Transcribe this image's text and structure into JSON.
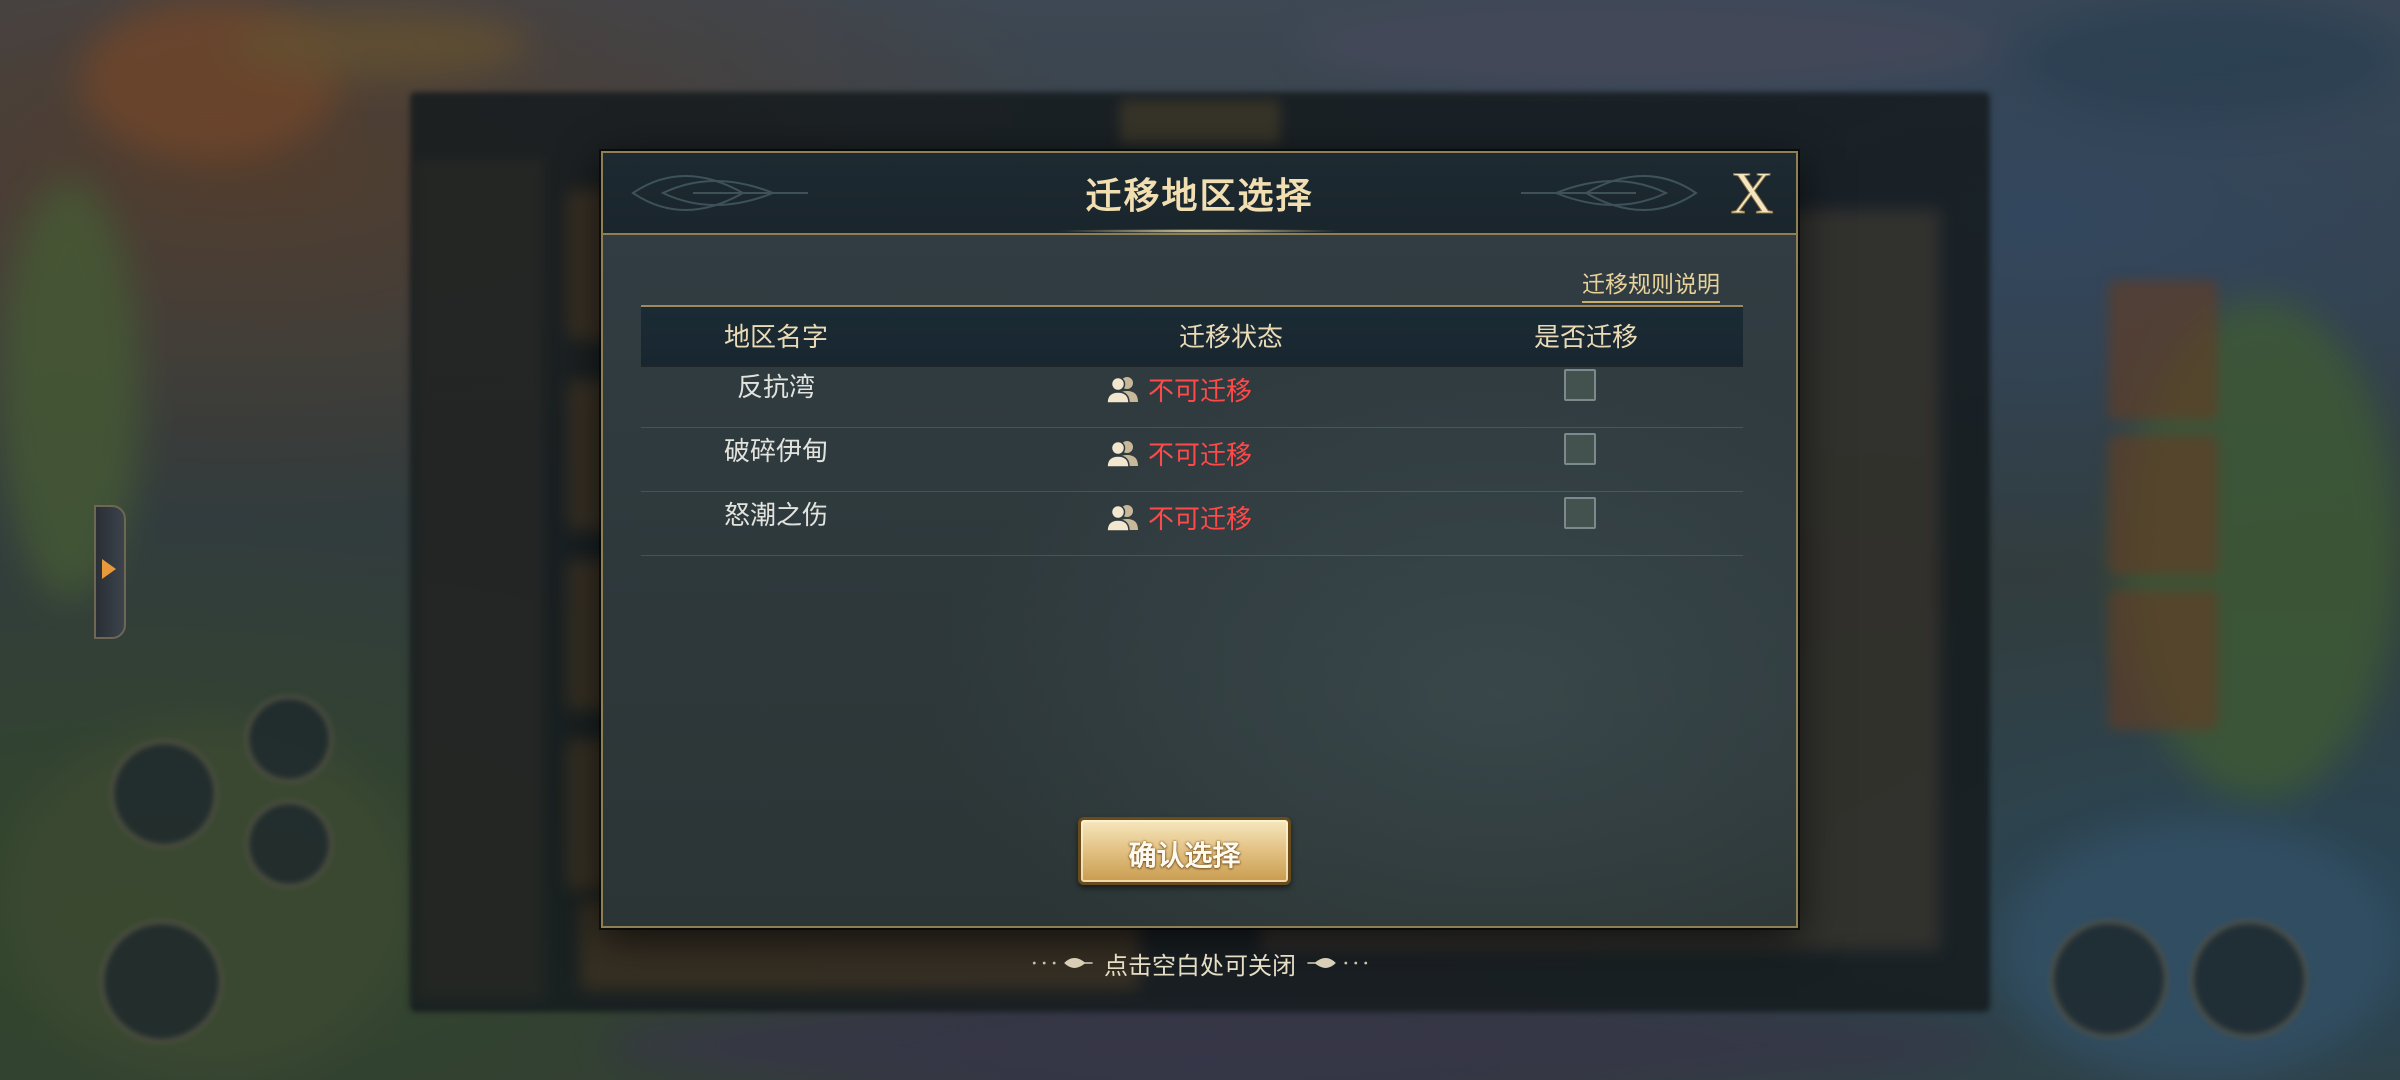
{
  "dialog": {
    "title": "迁移地区选择",
    "close_label": "X",
    "rules_link": "迁移规则说明",
    "columns": {
      "name": "地区名字",
      "status": "迁移状态",
      "choose": "是否迁移"
    },
    "rows": [
      {
        "name": "反抗湾",
        "status": "不可迁移",
        "checked": false
      },
      {
        "name": "破碎伊甸",
        "status": "不可迁移",
        "checked": false
      },
      {
        "name": "怒潮之伤",
        "status": "不可迁移",
        "checked": false
      }
    ],
    "confirm_label": "确认选择"
  },
  "hint": {
    "tap_close": "点击空白处可关闭"
  },
  "colors": {
    "title_gold": "#f1dfb2",
    "status_red": "#ff4a4a",
    "accent_gold": "#8f7f55"
  },
  "icons": {
    "status": "users-icon",
    "close": "close-x-icon",
    "side_tab": "chevron-right-icon"
  }
}
